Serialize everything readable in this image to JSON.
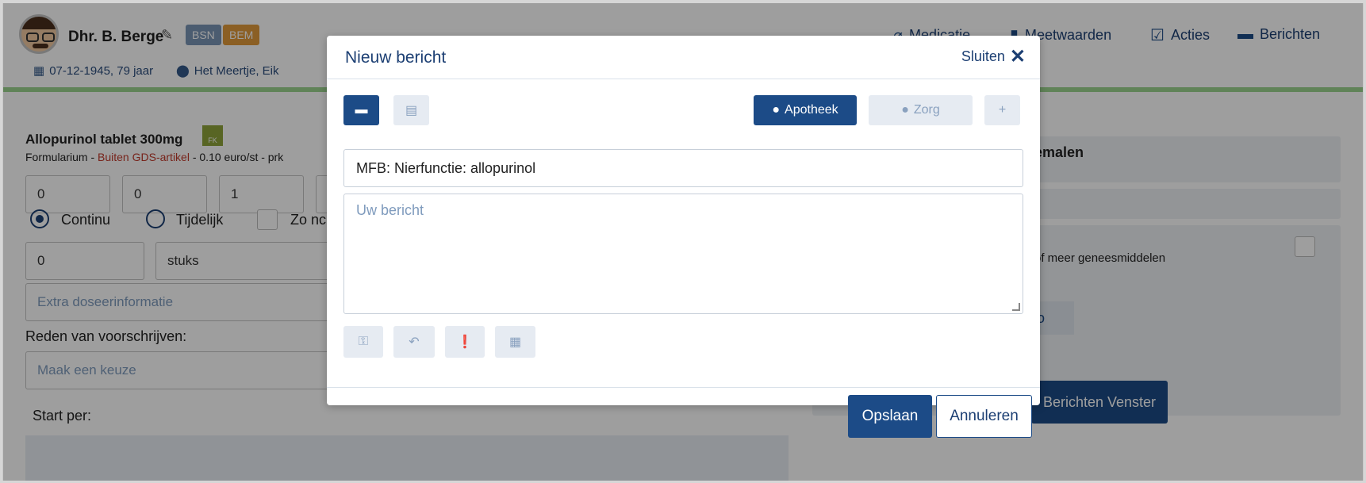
{
  "patient": {
    "name": "Dhr. B. Berge",
    "badge_bsn": "BSN",
    "badge_bem": "BEM",
    "dob": "07-12-1945, 79 jaar",
    "location": "Het Meertje, Eik"
  },
  "nav": {
    "medicatie": "Medicatie",
    "meetwaarden": "Meetwaarden",
    "acties": "Acties",
    "berichten": "Berichten"
  },
  "background": {
    "med_name": "Allopurinol tablet 300mg",
    "fk_label": "FK",
    "form_prefix": "Formularium  -  ",
    "form_red": "Buiten GDS-artikel",
    "form_rest": " - 0.10 euro/st - prk",
    "dose": [
      "0",
      "0",
      "1"
    ],
    "radio_continu": "Continu",
    "radio_tijdelijk": "Tijdelijk",
    "check_zo": "Zo nc",
    "qty": "0",
    "unit": "stuks",
    "extra_placeholder": "Extra doseerinformatie",
    "reden_label": "Reden van voorschrijven:",
    "reden_placeholder": "Maak een keuze",
    "start_label": "Start per:",
    "right_title": "emalen",
    "right_text": "of meer geneesmiddelen",
    "right_tab": "fo",
    "right_button": "Berichten Venster"
  },
  "modal": {
    "title": "Nieuw bericht",
    "close_label": "Sluiten",
    "recipient_apotheek": "Apotheek",
    "recipient_zorg": "Zorg",
    "add_label": "+",
    "subject_value": "MFB: Nierfunctie: allopurinol",
    "message_placeholder": "Uw bericht",
    "save_label": "Opslaan",
    "cancel_label": "Annuleren"
  },
  "colors": {
    "primary": "#1c4b87",
    "accent_green": "#9bd38e",
    "badge_bsn": "#7a95b5",
    "badge_bem": "#e09a3b"
  }
}
